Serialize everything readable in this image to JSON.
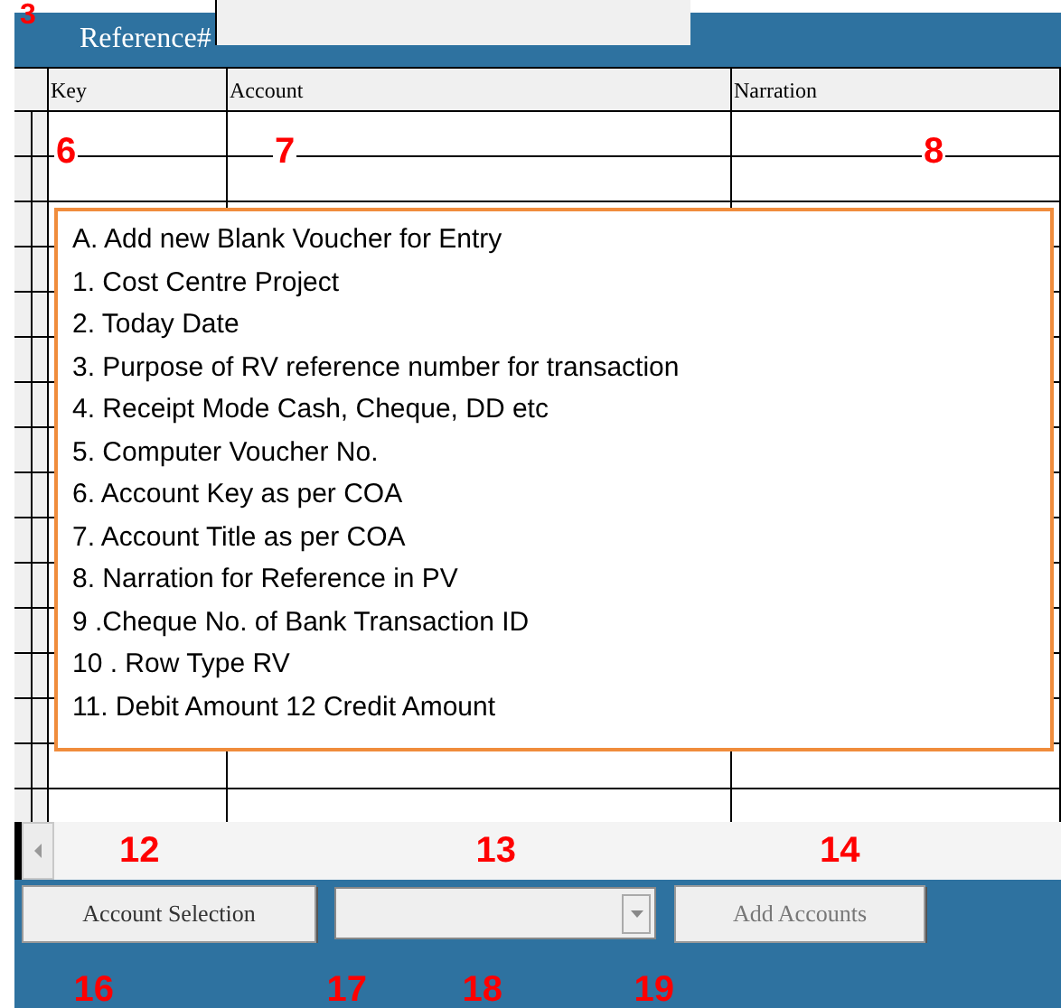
{
  "top_marker": "3",
  "reference": {
    "label": "Reference#"
  },
  "columns": [
    "Key",
    "Account",
    "Narration"
  ],
  "cell_markers": [
    "6",
    "7",
    "8"
  ],
  "notes": [
    "A. Add new Blank Voucher for Entry",
    "1. Cost Centre Project",
    "2. Today Date",
    "3. Purpose of RV reference number for transaction",
    "4. Receipt Mode Cash, Cheque, DD etc",
    "5. Computer Voucher No.",
    "6. Account Key as per COA",
    "7. Account Title as per COA",
    "8. Narration for Reference  in PV",
    "9 .Cheque No. of Bank Transaction ID",
    "10 . Row Type RV",
    "11. Debit Amount 12 Credit Amount"
  ],
  "scroll_markers": [
    "12",
    "13",
    "14"
  ],
  "controls": [
    {
      "kind": "button",
      "label": "Account Selection",
      "disabled": false
    },
    {
      "kind": "dropdown"
    },
    {
      "kind": "button",
      "label": "Add Accounts",
      "disabled": true
    }
  ],
  "bottom_markers": [
    "16",
    "17",
    "18",
    "19"
  ]
}
